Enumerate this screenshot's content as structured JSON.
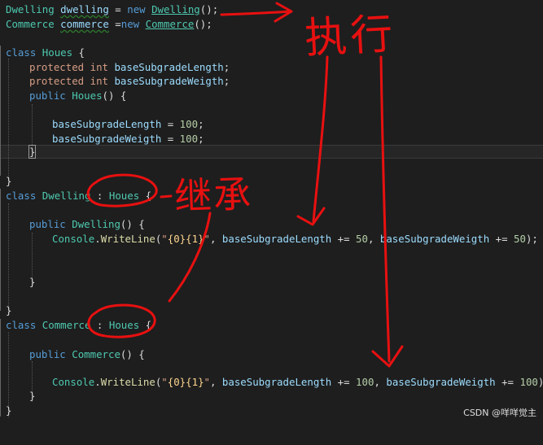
{
  "code": {
    "l1": {
      "a": "Dwelling",
      "b": "dwelling",
      "c": " = ",
      "d": "new",
      "e": " ",
      "f": "Dwelling",
      "g": "();"
    },
    "l2": {
      "a": "Commerce",
      "b": "commerce",
      "c": " =",
      "d": "new",
      "e": " ",
      "f": "Commerce",
      "g": "();"
    },
    "l3": {
      "a": "class",
      "b": "Houes",
      "c": " {"
    },
    "l4": {
      "a": "protected",
      "b": "int",
      "c": "baseSubgradeLength",
      "d": ";"
    },
    "l5": {
      "a": "protected",
      "b": "int",
      "c": "baseSubgradeWeigth",
      "d": ";"
    },
    "l6": {
      "a": "public",
      "b": "Houes",
      "c": "() {"
    },
    "l7": {
      "a": "baseSubgradeLength",
      "b": " = ",
      "c": "100",
      "d": ";"
    },
    "l8": {
      "a": "baseSubgradeWeigth",
      "b": " = ",
      "c": "100",
      "d": ";"
    },
    "l9": {
      "a": "}"
    },
    "l10": {
      "a": "}"
    },
    "l11": {
      "a": "class",
      "b": "Dwelling",
      "c": " : ",
      "d": "Houes",
      "e": " {"
    },
    "l12": {
      "a": "public",
      "b": "Dwelling",
      "c": "() {"
    },
    "l13": {
      "a": "Console",
      "b": ".",
      "c": "WriteLine",
      "d": "(",
      "e": "\"",
      "f": "{0}{1}",
      "g": "\"",
      "h": ", ",
      "i": "baseSubgradeLength",
      "j": " += ",
      "k": "50",
      "l": ", ",
      "m": "baseSubgradeWeigth",
      "n": " += ",
      "o": "50",
      "p": ");"
    },
    "l14": {
      "a": "}"
    },
    "l15": {
      "a": "}"
    },
    "l16": {
      "a": "class",
      "b": "Commerce",
      "c": " : ",
      "d": "Houes",
      "e": " {"
    },
    "l17": {
      "a": "public",
      "b": "Commerce",
      "c": "() {"
    },
    "l18": {
      "a": "Console",
      "b": ".",
      "c": "WriteLine",
      "d": "(",
      "e": "\"",
      "f": "{0}{1}",
      "g": "\"",
      "h": ", ",
      "i": "baseSubgradeLength",
      "j": " += ",
      "k": "100",
      "l": ", ",
      "m": "baseSubgradeWeigth",
      "n": " += ",
      "o": "100",
      "p": ");"
    },
    "l19": {
      "a": "}"
    },
    "l20": {
      "a": "}"
    }
  },
  "annotations": {
    "execute_text": "执行",
    "inherit_text": "继承",
    "ink_color": "#e81010"
  },
  "watermark": "CSDN @咩咩觉主",
  "colors": {
    "background": "#1e1e1e",
    "keyword": "#569cd6",
    "type": "#4ec9b0",
    "identifier": "#9cdcfe",
    "number": "#b5cea8",
    "method": "#dcdcaa"
  }
}
